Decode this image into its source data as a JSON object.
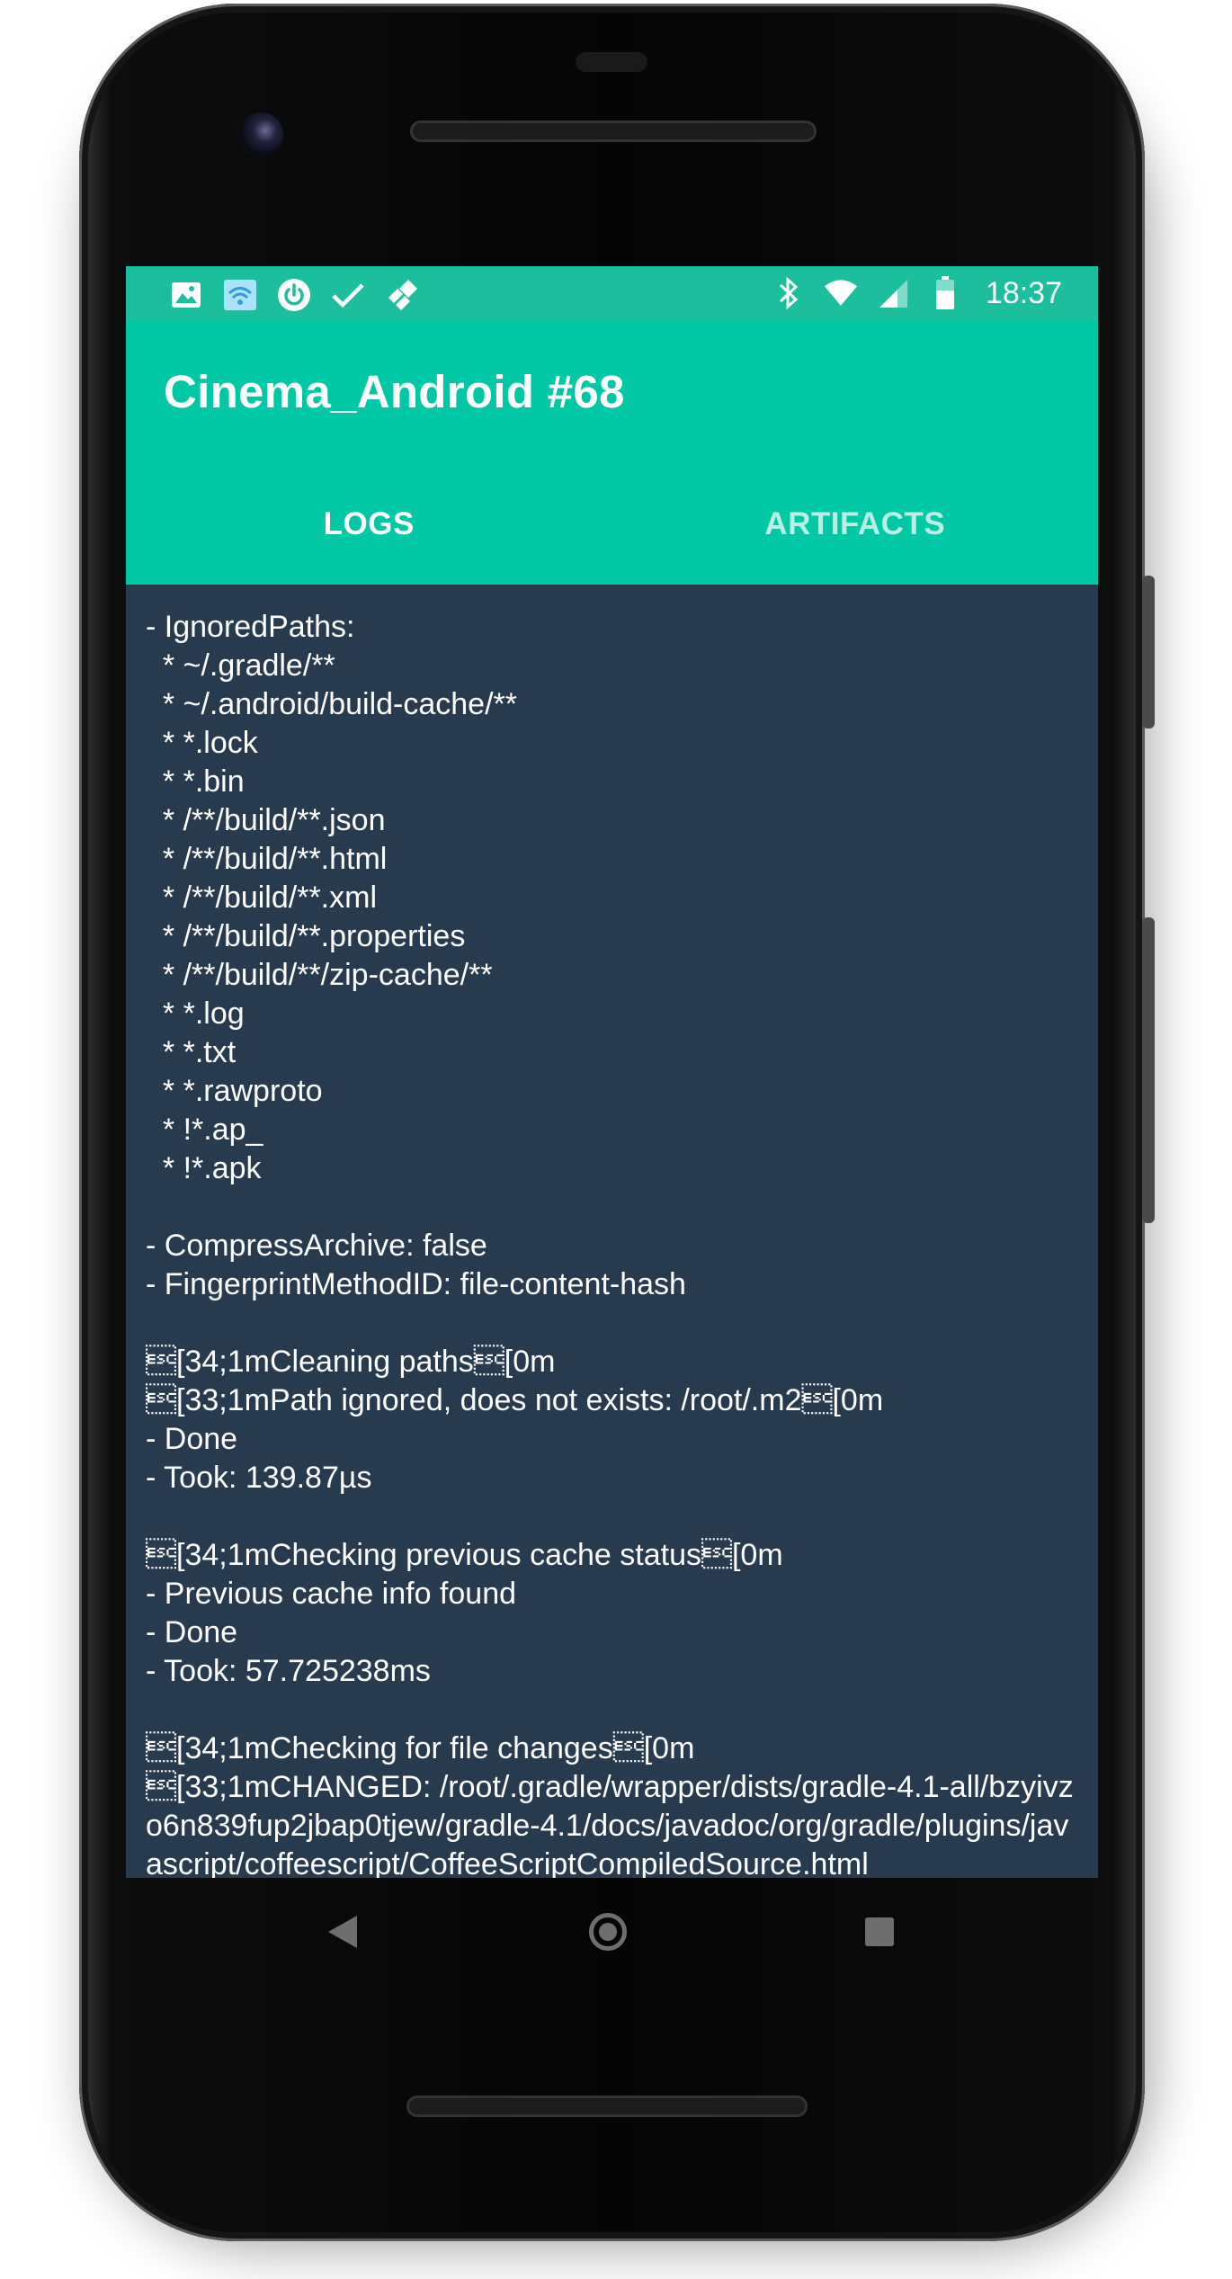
{
  "colors": {
    "status_bar": "#1dbe9d",
    "app_bar": "#00c8a5",
    "log_background": "#283a4e",
    "text": "#ffffff"
  },
  "status_bar": {
    "left_icons": [
      "image-icon",
      "wifi-card-icon",
      "power-icon",
      "check-icon",
      "jira-icon"
    ],
    "right_icons": [
      "bluetooth-icon",
      "wifi-icon",
      "signal-icon",
      "battery-icon"
    ],
    "time": "18:37"
  },
  "app_bar": {
    "title": "Cinema_Android #68"
  },
  "tabs": [
    {
      "label": "LOGS",
      "active": true
    },
    {
      "label": "ARTIFACTS",
      "active": false
    }
  ],
  "log": {
    "text": "- IgnoredPaths:\n  * ~/.gradle/**\n  * ~/.android/build-cache/**\n  * *.lock\n  * *.bin\n  * /**/build/**.json\n  * /**/build/**.html\n  * /**/build/**.xml\n  * /**/build/**.properties\n  * /**/build/**/zip-cache/**\n  * *.log\n  * *.txt\n  * *.rawproto\n  * !*.ap_\n  * !*.apk\n\n- CompressArchive: false\n- FingerprintMethodID: file-content-hash\n\n\u001b[34;1mCleaning paths\u001b[0m\n\u001b[33;1mPath ignored, does not exists: /root/.m2\u001b[0m\n- Done\n- Took: 139.87µs\n\n\u001b[34;1mChecking previous cache status\u001b[0m\n- Previous cache info found\n- Done\n- Took: 57.725238ms\n\n\u001b[34;1mChecking for file changes\u001b[0m\n\u001b[33;1mCHANGED: /root/.gradle/wrapper/dists/gradle-4.1-all/bzyivzo6n839fup2jbap0tjew/gradle-4.1/docs/javadoc/org/gradle/plugins/javascript/coffeescript/CoffeeScriptCompiledSource.html"
  },
  "nav": {
    "icons": [
      "back-icon",
      "home-icon",
      "recents-icon"
    ]
  }
}
